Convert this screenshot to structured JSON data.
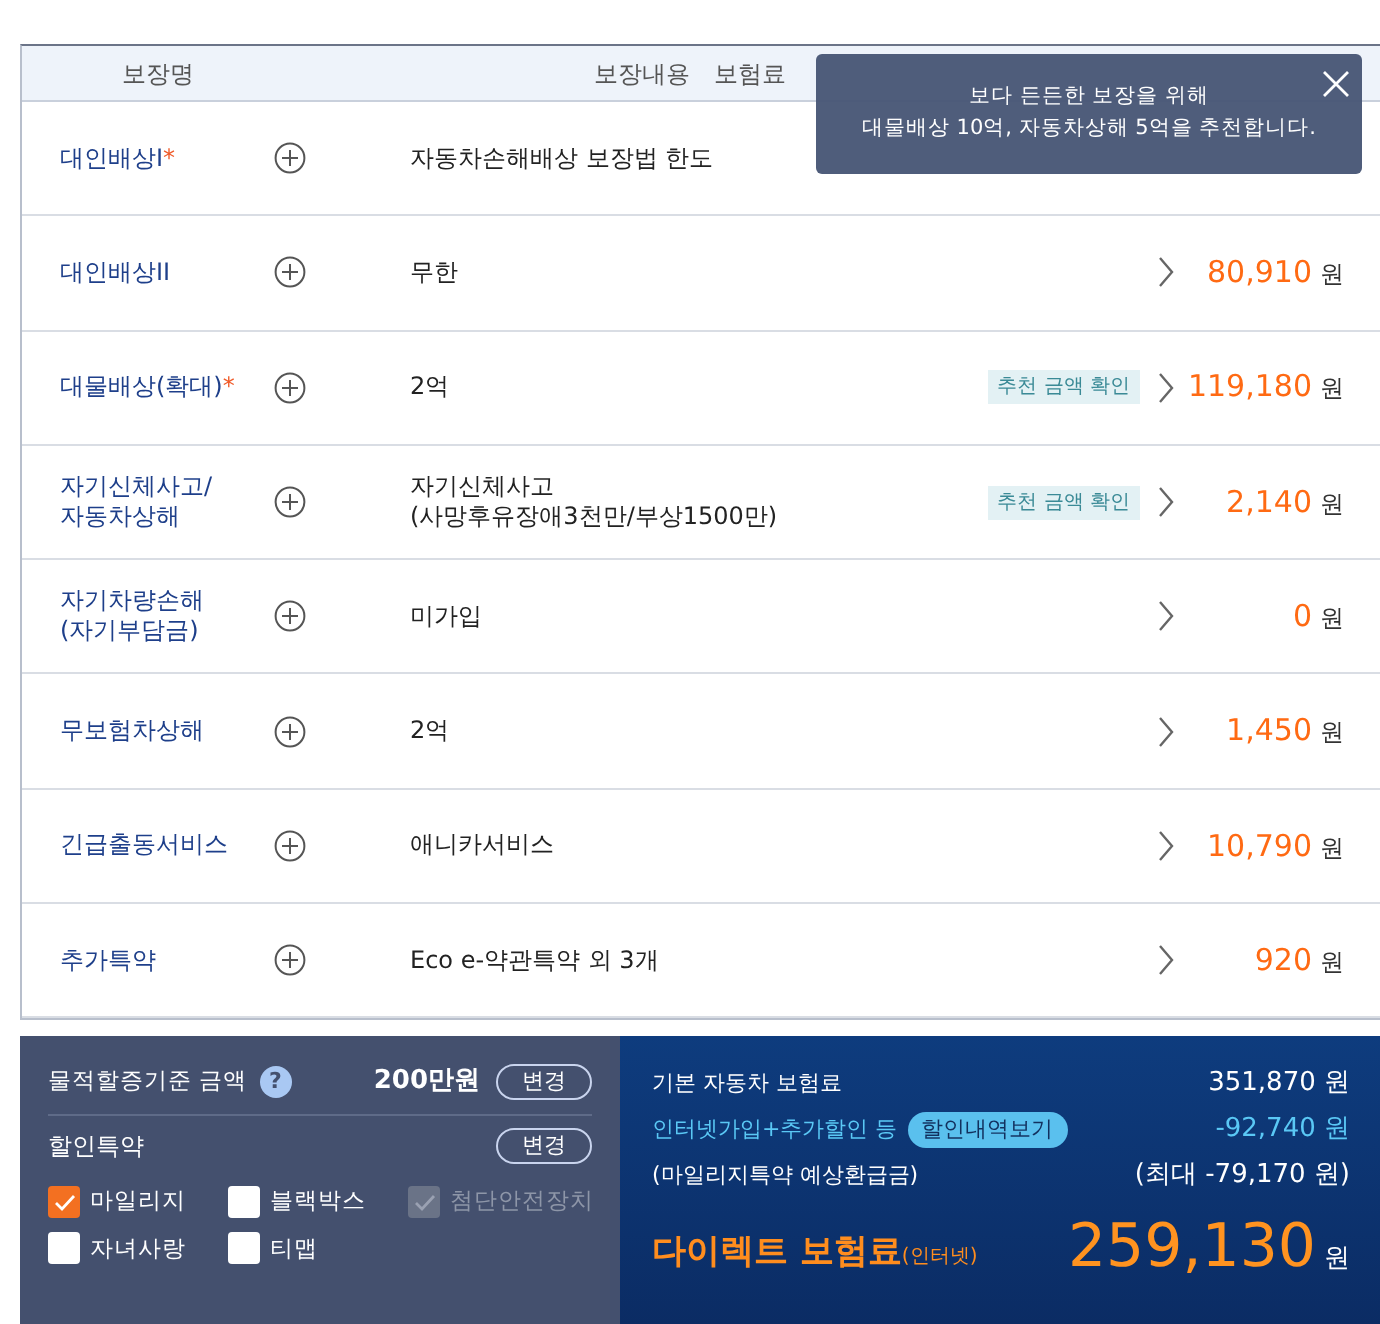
{
  "table": {
    "columns": [
      "보장명",
      "보장내용",
      "보험료"
    ],
    "rows": [
      {
        "name": "대인배상I",
        "required_mark": "*",
        "content": "자동차손해배상 보장법 한도"
      },
      {
        "name": "대인배상II",
        "content": "무한",
        "price": "80,910",
        "unit": "원"
      },
      {
        "name": "대물배상(확대)",
        "required_mark": "*",
        "content": "2억",
        "recommend": "추천 금액 확인",
        "price": "119,180",
        "unit": "원"
      },
      {
        "name": "자기신체사고/\n자동차상해",
        "content": "자기신체사고\n(사망후유장애3천만/부상1500만)",
        "recommend": "추천 금액 확인",
        "price": "2,140",
        "unit": "원"
      },
      {
        "name": "자기차량손해\n(자기부담금)",
        "content": "미가입",
        "price": "0",
        "unit": "원"
      },
      {
        "name": "무보험차상해",
        "content": "2억",
        "price": "1,450",
        "unit": "원"
      },
      {
        "name": "긴급출동서비스",
        "content": "애니카서비스",
        "price": "10,790",
        "unit": "원"
      },
      {
        "name": "추가특약",
        "content": "Eco e-약관특약 외 3개",
        "price": "920",
        "unit": "원"
      }
    ]
  },
  "tooltip": {
    "lines": [
      "보다 든든한 보장을 위해",
      "대물배상 10억, 자동차상해 5억을 추천합니다."
    ]
  },
  "surcharge": {
    "label": "물적할증기준 금액",
    "help": "?",
    "value": "200만원",
    "button": "변경"
  },
  "discounts": {
    "title": "할인특약",
    "button": "변경",
    "options": [
      {
        "label": "마일리지",
        "checked": true,
        "disabled": false
      },
      {
        "label": "블랙박스",
        "checked": false,
        "disabled": false
      },
      {
        "label": "첨단안전장치",
        "checked": true,
        "disabled": true
      },
      {
        "label": "자녀사랑",
        "checked": false,
        "disabled": false
      },
      {
        "label": "티맵",
        "checked": false,
        "disabled": false
      }
    ]
  },
  "summary": {
    "lines": [
      {
        "kind": "base",
        "label": "기본 자동차 보험료",
        "value": "351,870 원"
      },
      {
        "kind": "discount",
        "label": "인터넷가입+추가할인 등",
        "link": "할인내역보기",
        "value": "-92,740 원"
      },
      {
        "kind": "note",
        "label": "(마일리지특약 예상환급금)",
        "value": "(최대 -79,170 원)"
      }
    ],
    "total_label": "다이렉트 보험료",
    "total_sub": "(인터넷)",
    "total": "259,130",
    "total_unit": "원"
  }
}
